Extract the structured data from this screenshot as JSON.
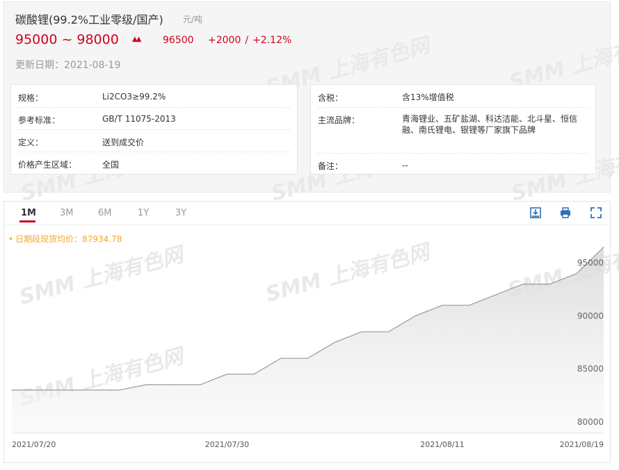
{
  "product": {
    "title": "碳酸锂(99.2%工业零级/国产)",
    "unit": "元/吨",
    "range_low": "95000",
    "range_sep": "~",
    "range_high": "98000",
    "avg": "96500",
    "change": "+2000",
    "change_sep": "/",
    "change_pct": "+2.12%",
    "updated": "更新日期：2021-08-19"
  },
  "specs_left": [
    {
      "key": "规格：",
      "value": "Li2CO3≥99.2%"
    },
    {
      "key": "参考标准：",
      "value": "GB/T 11075-2013"
    },
    {
      "key": "定义：",
      "value": "送到成交价"
    },
    {
      "key": "价格产生区域：",
      "value": "全国"
    }
  ],
  "specs_right": [
    {
      "key": "含税：",
      "value": "含13%增值税"
    },
    {
      "key": "主流品牌：",
      "value": "青海锂业、五矿盐湖、科达洁能、北斗星、恒信融、南氏锂电、银锂等厂家旗下品牌"
    },
    {
      "key": "备注：",
      "value": "--"
    }
  ],
  "tabs": [
    "1M",
    "3M",
    "6M",
    "1Y",
    "3Y"
  ],
  "active_tab": "1M",
  "tools": [
    "download-image-icon",
    "print-icon",
    "fullscreen-icon"
  ],
  "watermark": "SMM 上海有色网",
  "avg_label": "日期段现货均价：87934.78",
  "colors": {
    "red": "#d0021b",
    "orange": "#f5a623",
    "line": "#999999"
  },
  "chart_data": {
    "type": "area",
    "title": "",
    "xlabel": "",
    "ylabel": "",
    "ylim": [
      79000,
      97500
    ],
    "yticks": [
      80000,
      85000,
      90000,
      95000
    ],
    "xticks": [
      "2021/07/20",
      "2021/07/30",
      "2021/08/11",
      "2021/08/19"
    ],
    "x": [
      "2021/07/20",
      "2021/07/21",
      "2021/07/22",
      "2021/07/23",
      "2021/07/26",
      "2021/07/27",
      "2021/07/28",
      "2021/07/29",
      "2021/07/30",
      "2021/08/02",
      "2021/08/03",
      "2021/08/04",
      "2021/08/05",
      "2021/08/06",
      "2021/08/09",
      "2021/08/10",
      "2021/08/11",
      "2021/08/12",
      "2021/08/13",
      "2021/08/16",
      "2021/08/17",
      "2021/08/18",
      "2021/08/19"
    ],
    "series": [
      {
        "values": [
          83000,
          83000,
          83000,
          83000,
          83000,
          83500,
          83500,
          83500,
          84500,
          84500,
          86000,
          86000,
          87500,
          88500,
          88500,
          90000,
          91000,
          91000,
          92000,
          93000,
          93000,
          94000,
          96500
        ]
      }
    ],
    "grid": false
  }
}
